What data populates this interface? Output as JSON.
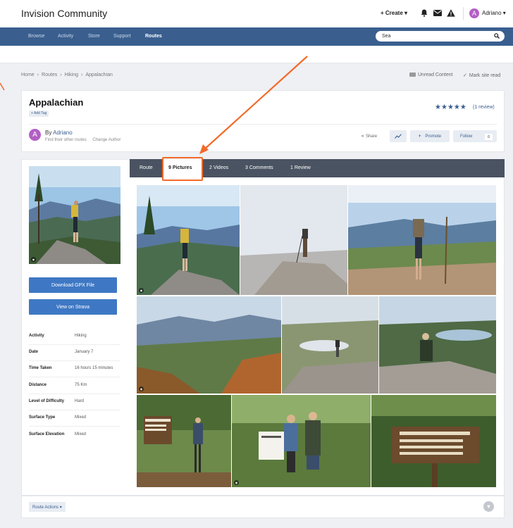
{
  "header": {
    "brand": "Invision Community",
    "create_label": "+ Create ▾",
    "user_initial": "A",
    "user_name": "Adriano ▾"
  },
  "nav": {
    "items": [
      {
        "label": "Browse"
      },
      {
        "label": "Activity"
      },
      {
        "label": "Store"
      },
      {
        "label": "Support"
      },
      {
        "label": "Routes"
      }
    ],
    "search_value": "Sea"
  },
  "breadcrumb": {
    "items": [
      "Home",
      "›",
      "Routes",
      "›",
      "Hiking",
      "›",
      "Appalachian"
    ]
  },
  "actions": {
    "unread": "Unread Content",
    "mark_read": "Mark site read"
  },
  "route": {
    "title": "Appalachian",
    "add_tag": "+ Add Tag",
    "rating": 5,
    "review_count": "(1 review)",
    "author_initial": "A",
    "by_label": "By",
    "author": "Adriano",
    "find_routes": "Find their other routes",
    "change_author": "Change Author",
    "share": "Share",
    "promote": "Promote",
    "follow": "Follow",
    "follow_count": "0"
  },
  "sidebar": {
    "gpx_button": "Download GPX File",
    "strava_button": "View on Strava",
    "info": [
      {
        "key": "Activity",
        "value": "Hiking"
      },
      {
        "key": "Date",
        "value": "January 7"
      },
      {
        "key": "Time Taken",
        "value": "16 hours 15 minutes"
      },
      {
        "key": "Distance",
        "value": "75 Km"
      },
      {
        "key": "Level of Difficulty",
        "value": "Hard"
      },
      {
        "key": "Surface Type",
        "value": "Mixed"
      },
      {
        "key": "Surface Elevation",
        "value": "Mixed"
      }
    ]
  },
  "tabs": [
    {
      "label": "Route"
    },
    {
      "label": "9 Pictures"
    },
    {
      "label": "2 Videos"
    },
    {
      "label": "3 Comments"
    },
    {
      "label": "1 Review"
    }
  ],
  "footer": {
    "route_actions": "Route Actions ▾"
  },
  "colors": {
    "nav": "#3a5f8f",
    "button": "#3e78c4",
    "highlight": "#f26a2a",
    "tabbar": "#4a5361"
  }
}
